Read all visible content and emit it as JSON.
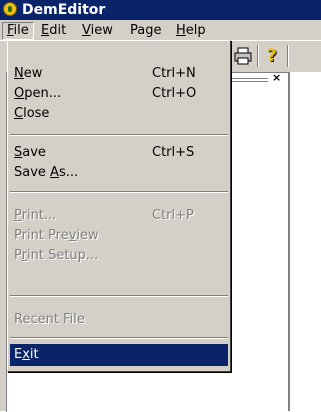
{
  "window": {
    "title": "DemEditor"
  },
  "menubar": {
    "items": [
      {
        "label": "File",
        "accel": "F",
        "rest": "ile"
      },
      {
        "label": "Edit",
        "accel": "E",
        "rest": "dit"
      },
      {
        "label": "View",
        "accel": "V",
        "rest": "iew"
      },
      {
        "label": "Page",
        "accel": "",
        "rest": "Page"
      },
      {
        "label": "Help",
        "accel": "H",
        "rest": "elp"
      }
    ]
  },
  "file_menu": {
    "new": {
      "a": "N",
      "b": "ew",
      "shortcut": "Ctrl+N"
    },
    "open": {
      "a": "O",
      "b": "pen...",
      "shortcut": "Ctrl+O"
    },
    "close": {
      "a": "C",
      "b": "lose"
    },
    "save": {
      "a": "S",
      "b": "ave",
      "shortcut": "Ctrl+S"
    },
    "save_as": {
      "pre": "Save ",
      "a": "A",
      "b": "s..."
    },
    "print": {
      "a": "P",
      "b": "rint...",
      "shortcut": "Ctrl+P"
    },
    "print_preview": {
      "pre": "Print Pre",
      "a": "v",
      "b": "iew"
    },
    "print_setup": {
      "pre": "P",
      "a": "r",
      "b": "int Setup..."
    },
    "recent_file": "Recent File",
    "exit": {
      "pre": "E",
      "a": "x",
      "b": "it"
    }
  },
  "colors": {
    "titlebar": "#0a246a",
    "selection": "#0a246a",
    "face": "#d4d0c8"
  },
  "icons": [
    "app-icon",
    "print-icon",
    "help-icon",
    "close-icon"
  ]
}
